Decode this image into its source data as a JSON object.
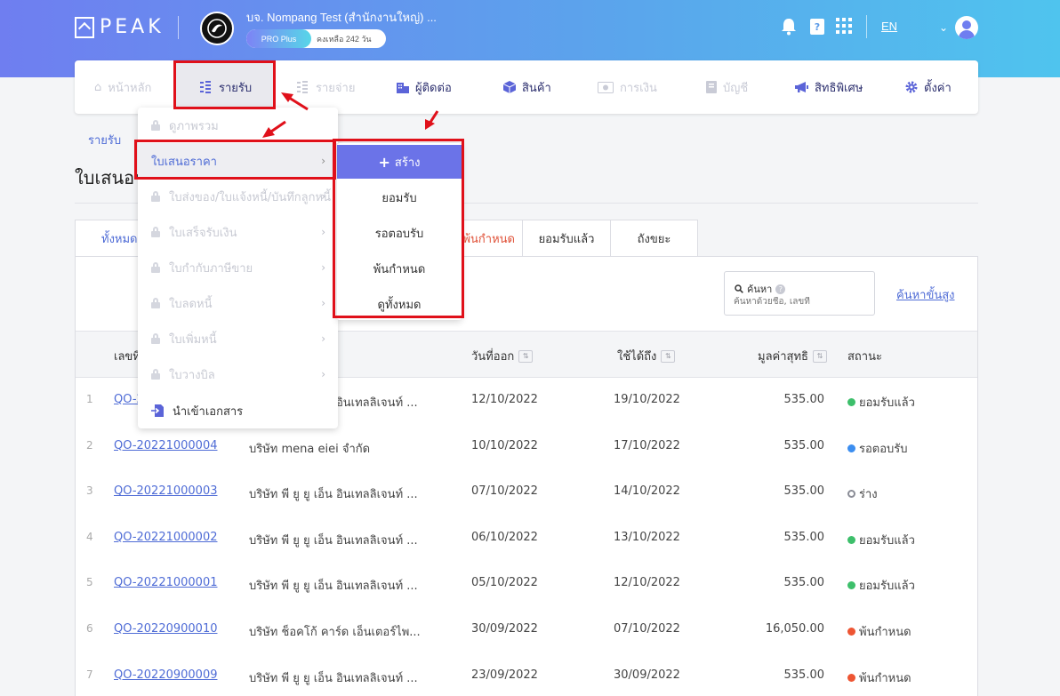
{
  "header": {
    "logo_text": "PEAK",
    "company_name": "บจ. Nompang Test (สำนักงานใหญ่) ...",
    "plan_label": "PRO Plus",
    "plan_remaining": "คงเหลือ 242 วัน",
    "language": "EN"
  },
  "nav": {
    "home": "หน้าหลัก",
    "income": "รายรับ",
    "expense": "รายจ่าย",
    "contacts": "ผู้ติดต่อ",
    "products": "สินค้า",
    "finance": "การเงิน",
    "accounting": "บัญชี",
    "privileges": "สิทธิพิเศษ",
    "settings": "ตั้งค่า"
  },
  "breadcrumb": "รายรับ",
  "page_title": "ใบเสนอราคา",
  "tabs": {
    "all": "ทั้งหมด",
    "expired": "พ้นกำหนด",
    "approved": "ยอมรับแล้ว",
    "trash": "ถังขยะ"
  },
  "search": {
    "label": "ค้นหา",
    "help": "?",
    "placeholder": "ค้นหาด้วยชื่อ, เลขที่",
    "advanced": "ค้นหาขั้นสูง"
  },
  "table": {
    "columns": {
      "doc_no": "เลขที่",
      "issue_date": "วันที่ออก",
      "due_date": "ใช้ได้ถึง",
      "net_amount": "มูลค่าสุทธิ",
      "status": "สถานะ"
    },
    "rows": [
      {
        "no": "1",
        "doc": "QO-20221000005",
        "customer": "บริษัท พี ยู ยู เอ็น อินเทลลิเจนท์ ...",
        "issue": "12/10/2022",
        "due": "19/10/2022",
        "amount": "535.00",
        "status": "ยอมรับแล้ว",
        "status_color": "#3dbf6b"
      },
      {
        "no": "2",
        "doc": "QO-20221000004",
        "customer": "บริษัท mena eiei จำกัด",
        "issue": "10/10/2022",
        "due": "17/10/2022",
        "amount": "535.00",
        "status": "รอตอบรับ",
        "status_color": "#3c8ef0"
      },
      {
        "no": "3",
        "doc": "QO-20221000003",
        "customer": "บริษัท พี ยู ยู เอ็น อินเทลลิเจนท์ ...",
        "issue": "07/10/2022",
        "due": "14/10/2022",
        "amount": "535.00",
        "status": "ร่าง",
        "status_color": "hollow"
      },
      {
        "no": "4",
        "doc": "QO-20221000002",
        "customer": "บริษัท พี ยู ยู เอ็น อินเทลลิเจนท์ ...",
        "issue": "06/10/2022",
        "due": "13/10/2022",
        "amount": "535.00",
        "status": "ยอมรับแล้ว",
        "status_color": "#3dbf6b"
      },
      {
        "no": "5",
        "doc": "QO-20221000001",
        "customer": "บริษัท พี ยู ยู เอ็น อินเทลลิเจนท์ ...",
        "issue": "05/10/2022",
        "due": "12/10/2022",
        "amount": "535.00",
        "status": "ยอมรับแล้ว",
        "status_color": "#3dbf6b"
      },
      {
        "no": "6",
        "doc": "QO-20220900010",
        "customer": "บริษัท ช็อคโก้ คาร์ด เอ็นเตอร์ไพ...",
        "issue": "30/09/2022",
        "due": "07/10/2022",
        "amount": "16,050.00",
        "status": "พ้นกำหนด",
        "status_color": "#ee5533"
      },
      {
        "no": "7",
        "doc": "QO-20220900009",
        "customer": "บริษัท พี ยู ยู เอ็น อินเทลลิเจนท์ ...",
        "issue": "23/09/2022",
        "due": "30/09/2022",
        "amount": "535.00",
        "status": "พ้นกำหนด",
        "status_color": "#ee5533"
      }
    ]
  },
  "dropdown": {
    "items": [
      {
        "label": "ดูภาพรวม",
        "locked": true,
        "submenu": false
      },
      {
        "label": "ใบเสนอราคา",
        "locked": false,
        "submenu": true,
        "selected": true
      },
      {
        "label": "ใบส่งของ/ใบแจ้งหนี้/บันทึกลูกหนี้",
        "locked": true,
        "submenu": true
      },
      {
        "label": "ใบเสร็จรับเงิน",
        "locked": true,
        "submenu": true
      },
      {
        "label": "ใบกำกับภาษีขาย",
        "locked": true,
        "submenu": true
      },
      {
        "label": "ใบลดหนี้",
        "locked": true,
        "submenu": true
      },
      {
        "label": "ใบเพิ่มหนี้",
        "locked": true,
        "submenu": true
      },
      {
        "label": "ใบวางบิล",
        "locked": true,
        "submenu": true
      },
      {
        "label": "นำเข้าเอกสาร",
        "locked": false,
        "submenu": false
      }
    ]
  },
  "submenu": {
    "create": "สร้าง",
    "accept": "ยอมรับ",
    "pending": "รอตอบรับ",
    "expired": "พ้นกำหนด",
    "view_all": "ดูทั้งหมด"
  },
  "colors": {
    "accent": "#4f6cd6",
    "create_button": "#6b73e8",
    "highlight": "#e0101a"
  }
}
